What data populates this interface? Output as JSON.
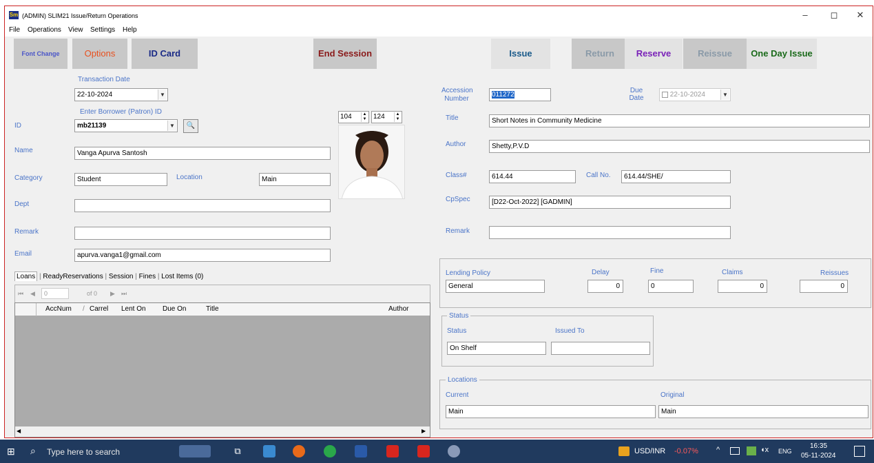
{
  "window": {
    "title": "(ADMIN) SLIM21 Issue/Return Operations",
    "icon": "Sm",
    "controls": {
      "minimize": "–",
      "maximize": "◻",
      "close": "✕"
    }
  },
  "menu": [
    "File",
    "Operations",
    "View",
    "Settings",
    "Help"
  ],
  "toolbar": {
    "font_change": "Font Change",
    "options": "Options",
    "id_card": "ID Card",
    "end_session": "End Session",
    "issue": "Issue",
    "return": "Return",
    "reserve": "Reserve",
    "reissue": "Reissue",
    "one_day_issue": "One Day Issue"
  },
  "borrower": {
    "transaction_date_label": "Transaction Date",
    "transaction_date": "22-10-2024",
    "enter_borrower_label": "Enter Borrower (Patron) ID",
    "id_label": "ID",
    "id_value": "mb21139",
    "name_label": "Name",
    "name_value": "Vanga Apurva Santosh",
    "category_label": "Category",
    "category_value": "Student",
    "location_label": "Location",
    "location_value": "Main",
    "dept_label": "Dept",
    "dept_value": "",
    "remark_label": "Remark",
    "remark_value": "",
    "email_label": "Email",
    "email_value": "apurva.vanga1@gmail.com",
    "photo_width": "104",
    "photo_height": "124"
  },
  "tabs": [
    "Loans",
    "ReadyReservations",
    "Session",
    "Fines",
    "Lost Items (0)"
  ],
  "pager": {
    "first": "⏮",
    "prev": "◀",
    "position": "0",
    "of": "of 0",
    "next": "▶",
    "last": "⏭"
  },
  "loans_grid": {
    "columns": [
      "AccNum",
      "Carrel",
      "Lent On",
      "Due On",
      "Title",
      "Author"
    ]
  },
  "item": {
    "accession_label": "Accession Number",
    "accession_value": "011272",
    "due_label": "Due Date",
    "due_value": "22-10-2024",
    "title_label": "Title",
    "title_value": "Short Notes in Community Medicine",
    "author_label": "Author",
    "author_value": "Shetty,P.V.D",
    "class_label": "Class#",
    "class_value": "614.44",
    "callno_label": "Call No.",
    "callno_value": "614.44/SHE/",
    "cpspec_label": "CpSpec",
    "cpspec_value": "[D22-Oct-2022] [GADMIN]",
    "remark_label": "Remark",
    "remark_value": ""
  },
  "policy": {
    "lending_policy_label": "Lending Policy",
    "lending_policy_value": "General",
    "delay_label": "Delay",
    "delay_value": "0",
    "fine_label": "Fine",
    "fine_value": "0",
    "claims_label": "Claims",
    "claims_value": "0",
    "reissues_label": "Reissues",
    "reissues_value": "0"
  },
  "status": {
    "group_label": "Status",
    "status_label": "Status",
    "status_value": "On Shelf",
    "issued_to_label": "Issued To",
    "issued_to_value": ""
  },
  "locations": {
    "group_label": "Locations",
    "current_label": "Current",
    "current_value": "Main",
    "original_label": "Original",
    "original_value": "Main"
  },
  "taskbar": {
    "search_placeholder": "Type here to search",
    "ticker": "USD/INR",
    "ticker_change": "-0.07%",
    "lang": "ENG",
    "time": "16:35",
    "date": "05-11-2024"
  },
  "colors": {
    "options": "#e8501e",
    "reserve": "#7a22b8",
    "one_day_issue": "#1a6a1a",
    "label": "#4a74c8",
    "accession_highlight": "#1f66c8"
  }
}
